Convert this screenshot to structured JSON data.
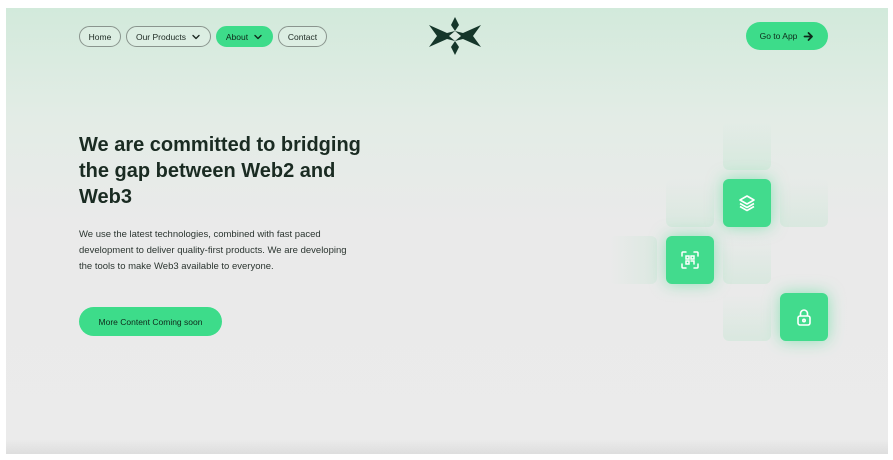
{
  "nav": {
    "items": [
      {
        "label": "Home",
        "active": false,
        "has_dropdown": false
      },
      {
        "label": "Our Products",
        "active": false,
        "has_dropdown": true
      },
      {
        "label": "About",
        "active": true,
        "has_dropdown": true
      },
      {
        "label": "Contact",
        "active": false,
        "has_dropdown": false
      }
    ]
  },
  "header": {
    "logo_icon": "stylized-x-logo",
    "cta_label": "Go to App",
    "cta_icon": "arrow-right-icon"
  },
  "hero": {
    "headline": "We are committed to bridging the gap between Web2 and Web3",
    "paragraph": "We use the latest technologies, combined with fast paced development to deliver quality-first products. We are developing the tools to make Web3 available to everyone.",
    "button_label": "More Content Coming soon"
  },
  "feature_icons": [
    "layers-icon",
    "qr-scan-icon",
    "lock-icon"
  ],
  "colors": {
    "accent": "#3ddc8a",
    "text_dark": "#1a2b22",
    "logo": "#15362a"
  }
}
